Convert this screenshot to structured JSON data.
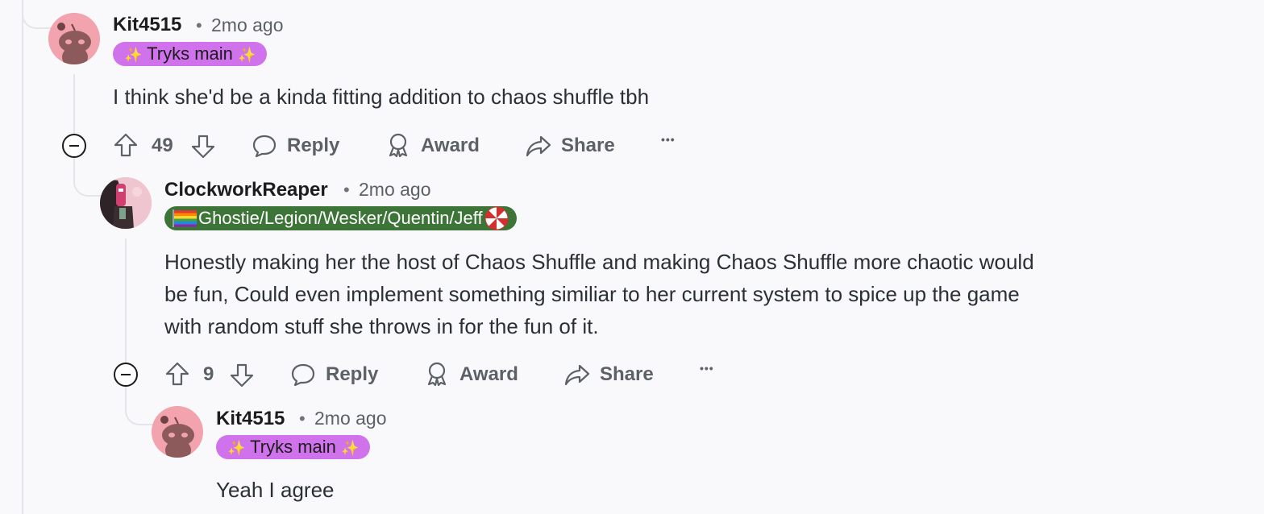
{
  "comments": [
    {
      "username": "Kit4515",
      "separator": "•",
      "time": "2mo ago",
      "flair": {
        "spark_left": "✨",
        "text": "Tryks main",
        "spark_right": "✨"
      },
      "body": "I think she'd be a kinda fitting addition to chaos shuffle tbh",
      "actions": {
        "votes": "49",
        "reply": "Reply",
        "award": "Award",
        "share": "Share",
        "more": "•••"
      }
    },
    {
      "username": "ClockworkReaper",
      "separator": "•",
      "time": "2mo ago",
      "flair": {
        "text": "Ghostie/Legion/Wesker/Quentin/Jeff"
      },
      "body_lines": [
        "Honestly making her the host of Chaos Shuffle and making Chaos Shuffle more chaotic would",
        "be fun, Could even implement something similiar to her current system to spice up the game",
        "with random stuff she throws in for the fun of it."
      ],
      "actions": {
        "votes": "9",
        "reply": "Reply",
        "award": "Award",
        "share": "Share",
        "more": "•••"
      }
    },
    {
      "username": "Kit4515",
      "separator": "•",
      "time": "2mo ago",
      "flair": {
        "spark_left": "✨",
        "text": "Tryks main",
        "spark_right": "✨"
      },
      "body": "Yeah I agree"
    }
  ],
  "colors": {
    "background": "#f9f9fb",
    "thread_line": "#e3e5e8",
    "pink_flair": "#cf72eb",
    "green_flair": "#3d7438",
    "avatar_pink": "#f2a3ad"
  }
}
